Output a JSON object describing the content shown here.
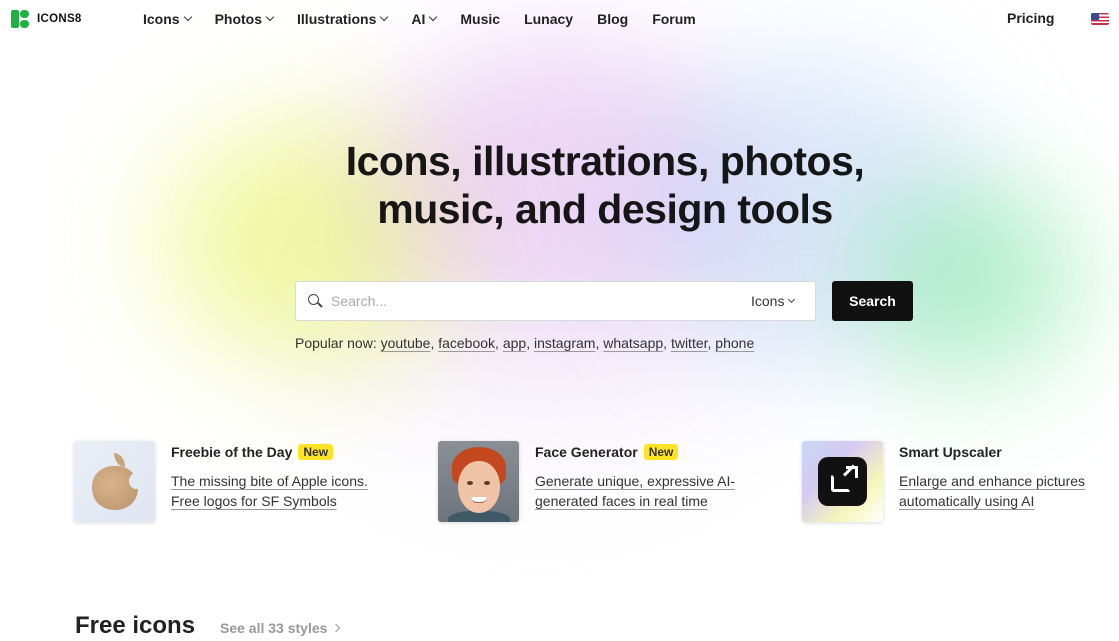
{
  "brand": {
    "name": "ICONS8",
    "color": "#1fb141"
  },
  "nav": {
    "items": [
      {
        "label": "Icons",
        "dropdown": true
      },
      {
        "label": "Photos",
        "dropdown": true
      },
      {
        "label": "Illustrations",
        "dropdown": true
      },
      {
        "label": "AI",
        "dropdown": true
      },
      {
        "label": "Music",
        "dropdown": false
      },
      {
        "label": "Lunacy",
        "dropdown": false
      },
      {
        "label": "Blog",
        "dropdown": false
      },
      {
        "label": "Forum",
        "dropdown": false
      }
    ],
    "pricing": "Pricing",
    "language_icon": "us-flag-icon"
  },
  "hero": {
    "title_line1": "Icons, illustrations, photos,",
    "title_line2": "music, and design tools"
  },
  "search": {
    "placeholder": "Search...",
    "value": "",
    "type": "Icons",
    "button": "Search"
  },
  "popular": {
    "label": "Popular now:",
    "items": [
      "youtube",
      "facebook",
      "app",
      "instagram",
      "whatsapp",
      "twitter",
      "phone"
    ]
  },
  "features": [
    {
      "title": "Freebie of the Day",
      "badge": "New",
      "description": "The missing bite of Apple icons. Free logos for SF Symbols",
      "thumb": "apple-logo"
    },
    {
      "title": "Face Generator",
      "badge": "New",
      "description": "Generate unique, expressive AI-generated faces in real time",
      "thumb": "face-photo"
    },
    {
      "title": "Smart Upscaler",
      "badge": "",
      "description": "Enlarge and enhance pictures automatically using AI",
      "thumb": "upscale-icon"
    }
  ],
  "free_icons": {
    "title": "Free icons",
    "see_all": "See all 33 styles"
  },
  "colors": {
    "search_button_bg": "#111111",
    "badge_bg": "#ffe426"
  }
}
